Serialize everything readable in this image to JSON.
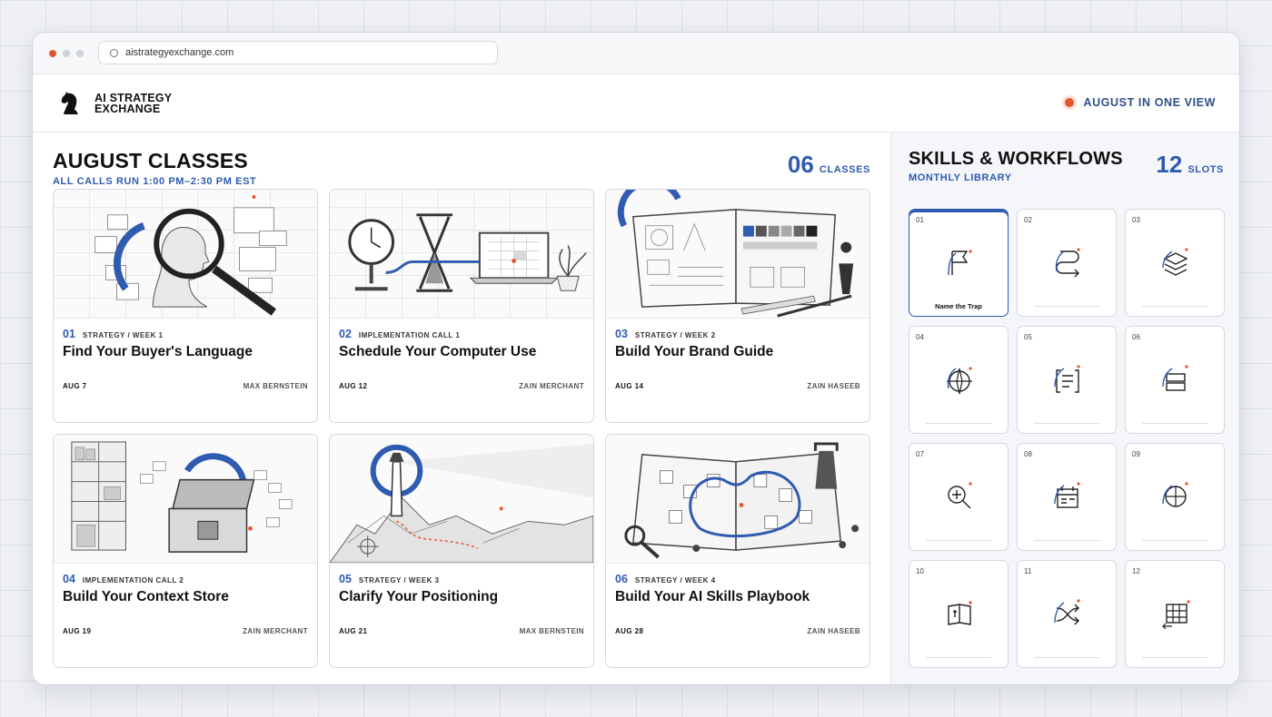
{
  "browser": {
    "url": "aistrategyexchange.com"
  },
  "header": {
    "brand_line1": "AI STRATEGY",
    "brand_line2": "EXCHANGE",
    "right_label": "AUGUST IN ONE VIEW"
  },
  "classes": {
    "title": "AUGUST CLASSES",
    "subtitle": "ALL CALLS RUN 1:00 PM–2:30 PM EST",
    "count": "06",
    "count_label": "CLASSES",
    "cards": [
      {
        "num": "01",
        "category": "STRATEGY / WEEK 1",
        "title": "Find Your Buyer's Language",
        "date": "AUG 7",
        "host": "MAX BERNSTEIN"
      },
      {
        "num": "02",
        "category": "IMPLEMENTATION CALL 1",
        "title": "Schedule Your Computer Use",
        "date": "AUG 12",
        "host": "ZAIN MERCHANT"
      },
      {
        "num": "03",
        "category": "STRATEGY / WEEK 2",
        "title": "Build Your Brand Guide",
        "date": "AUG 14",
        "host": "ZAIN HASEEB"
      },
      {
        "num": "04",
        "category": "IMPLEMENTATION CALL 2",
        "title": "Build Your Context Store",
        "date": "AUG 19",
        "host": "ZAIN MERCHANT"
      },
      {
        "num": "05",
        "category": "STRATEGY / WEEK 3",
        "title": "Clarify Your Positioning",
        "date": "AUG 21",
        "host": "MAX BERNSTEIN"
      },
      {
        "num": "06",
        "category": "STRATEGY / WEEK 4",
        "title": "Build Your AI Skills Playbook",
        "date": "AUG 28",
        "host": "ZAIN HASEEB"
      }
    ]
  },
  "skills": {
    "title": "SKILLS & WORKFLOWS",
    "subtitle": "MONTHLY LIBRARY",
    "count": "12",
    "count_label": "SLOTS",
    "slots": [
      {
        "num": "01",
        "icon": "flag-icon",
        "label": "Name the Trap"
      },
      {
        "num": "02",
        "icon": "route-arrow-icon",
        "label": ""
      },
      {
        "num": "03",
        "icon": "layers-icon",
        "label": ""
      },
      {
        "num": "04",
        "icon": "compass-icon",
        "label": ""
      },
      {
        "num": "05",
        "icon": "bracket-list-icon",
        "label": ""
      },
      {
        "num": "06",
        "icon": "stack-boxes-icon",
        "label": ""
      },
      {
        "num": "07",
        "icon": "zoom-in-icon",
        "label": ""
      },
      {
        "num": "08",
        "icon": "calendar-icon",
        "label": ""
      },
      {
        "num": "09",
        "icon": "target-globe-icon",
        "label": ""
      },
      {
        "num": "10",
        "icon": "book-icon",
        "label": ""
      },
      {
        "num": "11",
        "icon": "crossing-arrows-icon",
        "label": ""
      },
      {
        "num": "12",
        "icon": "grid-table-icon",
        "label": ""
      }
    ]
  },
  "colors": {
    "accent": "#2f5bb0",
    "live": "#e8542f"
  }
}
